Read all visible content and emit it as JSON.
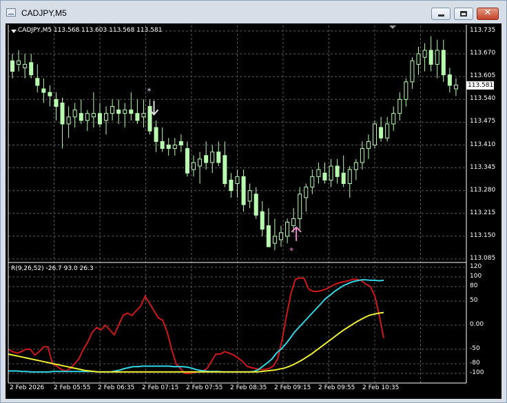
{
  "window": {
    "title": "CADJPY,M5",
    "buttons": {
      "minimize": "minimize",
      "maximize": "maximize",
      "close": "✕"
    }
  },
  "chart": {
    "header": "CADJPY,M5  113.568 113.603 113.568 113.581",
    "current_price": "113.581",
    "price_axis": [
      "113.735",
      "113.670",
      "113.605",
      "113.540",
      "113.475",
      "113.410",
      "113.345",
      "113.280",
      "113.215",
      "113.150",
      "113.085"
    ],
    "indicator_header": "R(9,26,52) -26.7 93.0 26.3",
    "indicator_axis": [
      "120",
      "100",
      "80",
      "50",
      "0.00",
      "-50",
      "-80",
      "-100"
    ],
    "time_axis": [
      "2 Feb 2026",
      "2 Feb 05:55",
      "2 Feb 06:35",
      "2 Feb 07:15",
      "2 Feb 07:55",
      "2 Feb 08:35",
      "2 Feb 09:15",
      "2 Feb 09:55",
      "2 Feb 10:35"
    ],
    "colors": {
      "background": "#000000",
      "grid": "#5a5a5a",
      "candle": "#b8ffb0",
      "arrow_down": "#e0e0e0",
      "arrow_up": "#f08ad0",
      "line_red": "#d01818",
      "line_cyan": "#30d8e8",
      "line_yellow": "#f0f030"
    },
    "signals": [
      {
        "type": "down-arrow",
        "price": 113.53
      },
      {
        "type": "up-arrow",
        "price": 113.22
      }
    ]
  },
  "chart_data": {
    "type": "candlestick",
    "title": "CADJPY,M5",
    "ylim": [
      113.085,
      113.735
    ],
    "ohlc": [
      [
        113.65,
        113.67,
        113.6,
        113.62
      ],
      [
        113.64,
        113.68,
        113.62,
        113.65
      ],
      [
        113.63,
        113.67,
        113.6,
        113.64
      ],
      [
        113.645,
        113.67,
        113.6,
        113.61
      ],
      [
        113.6,
        113.64,
        113.56,
        113.58
      ],
      [
        113.57,
        113.6,
        113.53,
        113.56
      ],
      [
        113.56,
        113.58,
        113.52,
        113.55
      ],
      [
        113.54,
        113.56,
        113.48,
        113.52
      ],
      [
        113.53,
        113.545,
        113.4,
        113.47
      ],
      [
        113.47,
        113.52,
        113.43,
        113.49
      ],
      [
        113.49,
        113.53,
        113.46,
        113.51
      ],
      [
        113.5,
        113.54,
        113.47,
        113.48
      ],
      [
        113.48,
        113.51,
        113.45,
        113.5
      ],
      [
        113.49,
        113.56,
        113.46,
        113.5
      ],
      [
        113.5,
        113.53,
        113.46,
        113.47
      ],
      [
        113.48,
        113.52,
        113.44,
        113.5
      ],
      [
        113.5,
        113.54,
        113.48,
        113.52
      ],
      [
        113.51,
        113.54,
        113.47,
        113.5
      ],
      [
        113.5,
        113.53,
        113.46,
        113.51
      ],
      [
        113.51,
        113.56,
        113.48,
        113.5
      ],
      [
        113.5,
        113.54,
        113.47,
        113.48
      ],
      [
        113.49,
        113.54,
        113.46,
        113.5
      ],
      [
        113.52,
        113.54,
        113.44,
        113.45
      ],
      [
        113.46,
        113.48,
        113.39,
        113.42
      ],
      [
        113.42,
        113.46,
        113.39,
        113.4
      ],
      [
        113.41,
        113.43,
        113.38,
        113.4
      ],
      [
        113.4,
        113.43,
        113.38,
        113.41
      ],
      [
        113.42,
        113.44,
        113.39,
        113.41
      ],
      [
        113.4,
        113.42,
        113.32,
        113.33
      ],
      [
        113.34,
        113.38,
        113.32,
        113.36
      ],
      [
        113.35,
        113.39,
        113.3,
        113.37
      ],
      [
        113.38,
        113.42,
        113.34,
        113.36
      ],
      [
        113.36,
        113.41,
        113.33,
        113.39
      ],
      [
        113.39,
        113.42,
        113.35,
        113.36
      ],
      [
        113.38,
        113.42,
        113.29,
        113.3
      ],
      [
        113.31,
        113.33,
        113.26,
        113.28
      ],
      [
        113.3,
        113.34,
        113.26,
        113.32
      ],
      [
        113.32,
        113.34,
        113.22,
        113.24
      ],
      [
        113.25,
        113.3,
        113.23,
        113.28
      ],
      [
        113.27,
        113.29,
        113.2,
        113.21
      ],
      [
        113.22,
        113.25,
        113.15,
        113.17
      ],
      [
        113.18,
        113.23,
        113.13,
        113.12
      ],
      [
        113.13,
        113.2,
        113.11,
        113.15
      ],
      [
        113.14,
        113.18,
        113.12,
        113.16
      ],
      [
        113.15,
        113.2,
        113.13,
        113.19
      ],
      [
        113.18,
        113.23,
        113.16,
        113.2
      ],
      [
        113.2,
        113.29,
        113.17,
        113.27
      ],
      [
        113.26,
        113.3,
        113.22,
        113.29
      ],
      [
        113.29,
        113.34,
        113.27,
        113.32
      ],
      [
        113.32,
        113.36,
        113.3,
        113.34
      ],
      [
        113.33,
        113.36,
        113.3,
        113.31
      ],
      [
        113.31,
        113.37,
        113.29,
        113.35
      ],
      [
        113.35,
        113.37,
        113.3,
        113.32
      ],
      [
        113.33,
        113.38,
        113.29,
        113.3
      ],
      [
        113.3,
        113.35,
        113.26,
        113.34
      ],
      [
        113.34,
        113.37,
        113.31,
        113.36
      ],
      [
        113.36,
        113.42,
        113.34,
        113.4
      ],
      [
        113.4,
        113.44,
        113.37,
        113.42
      ],
      [
        113.41,
        113.48,
        113.4,
        113.47
      ],
      [
        113.46,
        113.49,
        113.42,
        113.43
      ],
      [
        113.43,
        113.49,
        113.42,
        113.47
      ],
      [
        113.47,
        113.52,
        113.45,
        113.5
      ],
      [
        113.5,
        113.56,
        113.48,
        113.54
      ],
      [
        113.54,
        113.6,
        113.52,
        113.59
      ],
      [
        113.59,
        113.66,
        113.57,
        113.65
      ],
      [
        113.64,
        113.69,
        113.61,
        113.67
      ],
      [
        113.66,
        113.7,
        113.62,
        113.68
      ],
      [
        113.68,
        113.72,
        113.62,
        113.64
      ],
      [
        113.64,
        113.71,
        113.6,
        113.68
      ],
      [
        113.68,
        113.71,
        113.59,
        113.61
      ],
      [
        113.61,
        113.63,
        113.56,
        113.58
      ],
      [
        113.57,
        113.6,
        113.55,
        113.581
      ]
    ],
    "indicator": {
      "title": "R(9,26,52) -26.7 93.0 26.3",
      "ylim": [
        -110,
        120
      ],
      "series": [
        {
          "name": "R9",
          "color": "#d01818",
          "values": [
            -50,
            -55,
            -58,
            -55,
            -50,
            -50,
            -62,
            -55,
            -45,
            -45,
            -80,
            -85,
            -92,
            -95,
            -90,
            -80,
            -70,
            -50,
            -35,
            -15,
            -5,
            -10,
            0,
            -10,
            -20,
            0,
            20,
            25,
            20,
            30,
            40,
            60,
            45,
            30,
            15,
            10,
            -15,
            -50,
            -80,
            -90,
            -100,
            -100,
            -98,
            -97,
            -95,
            -90,
            -75,
            -60,
            -60,
            -55,
            -58,
            -62,
            -68,
            -75,
            -85,
            -88,
            -90,
            -92,
            -92,
            -90,
            -85,
            -70,
            -30,
            20,
            65,
            95,
            98,
            97,
            75,
            70,
            70,
            72,
            75,
            80,
            85,
            88,
            90,
            92,
            95,
            95,
            92,
            85,
            80,
            60,
            20,
            -26.7
          ]
        },
        {
          "name": "R26",
          "color": "#30d8e8",
          "values": [
            -95,
            -95,
            -95,
            -96,
            -96,
            -97,
            -97,
            -97,
            -97,
            -97,
            -96,
            -96,
            -96,
            -96,
            -96,
            -96,
            -96,
            -96,
            -96,
            -96,
            -97,
            -97,
            -97,
            -97,
            -95,
            -93,
            -90,
            -88,
            -86,
            -86,
            -85,
            -85,
            -85,
            -85,
            -85,
            -85,
            -85,
            -86,
            -86,
            -86,
            -87,
            -89,
            -92,
            -94,
            -95,
            -96,
            -96,
            -96,
            -97,
            -97,
            -97,
            -97,
            -97,
            -97,
            -97,
            -96,
            -92,
            -85,
            -78,
            -70,
            -58,
            -50,
            -40,
            -28,
            -15,
            -5,
            5,
            15,
            25,
            35,
            45,
            55,
            62,
            70,
            76,
            82,
            86,
            90,
            92,
            94,
            94,
            93,
            93,
            92,
            93
          ]
        },
        {
          "name": "R52",
          "color": "#f0f030",
          "values": [
            -60,
            -62,
            -64,
            -66,
            -68,
            -70,
            -72,
            -74,
            -76,
            -78,
            -80,
            -82,
            -84,
            -86,
            -88,
            -90,
            -92,
            -94,
            -95,
            -96,
            -97,
            -97,
            -97,
            -97,
            -97,
            -97,
            -97,
            -97,
            -97,
            -97,
            -97,
            -97,
            -97,
            -97,
            -97,
            -97,
            -97,
            -97,
            -97,
            -97,
            -97,
            -97,
            -97,
            -97,
            -97,
            -97,
            -97,
            -97,
            -97,
            -97,
            -97,
            -97,
            -97,
            -97,
            -97,
            -97,
            -96,
            -95,
            -94,
            -93,
            -91,
            -89,
            -86,
            -82,
            -77,
            -72,
            -66,
            -60,
            -53,
            -46,
            -39,
            -32,
            -25,
            -18,
            -11,
            -5,
            1,
            7,
            12,
            17,
            21,
            23,
            25,
            26.3
          ]
        }
      ]
    }
  }
}
